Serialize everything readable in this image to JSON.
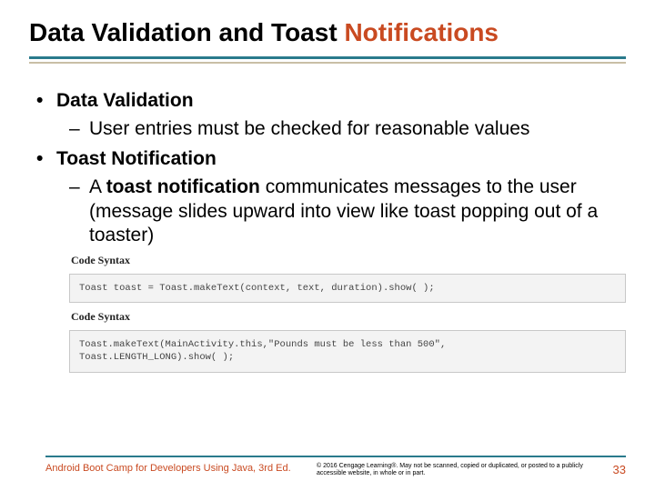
{
  "title_plain": "Data Validation and Toast ",
  "title_accent": "Notifications",
  "bullets": {
    "data_validation": {
      "heading": "Data Validation",
      "sub": "User entries must be checked for reasonable values"
    },
    "toast": {
      "heading": "Toast Notification",
      "sub_prefix": "A ",
      "sub_bold": "toast notification",
      "sub_rest": " communicates messages to the user (message slides upward into view like toast popping out of a toaster)"
    }
  },
  "code": {
    "label1": "Code Syntax",
    "box1": "Toast toast = Toast.makeText(context, text, duration).show( );",
    "label2": "Code Syntax",
    "box2": "Toast.makeText(MainActivity.this,\"Pounds must be less than 500\",\nToast.LENGTH_LONG).show( );"
  },
  "footer": {
    "book": "Android Boot Camp for Developers Using Java, 3rd Ed.",
    "copyright": "© 2016 Cengage Learning®. May not be scanned, copied or duplicated, or posted to a publicly accessible website, in whole or in part.",
    "page": "33"
  }
}
